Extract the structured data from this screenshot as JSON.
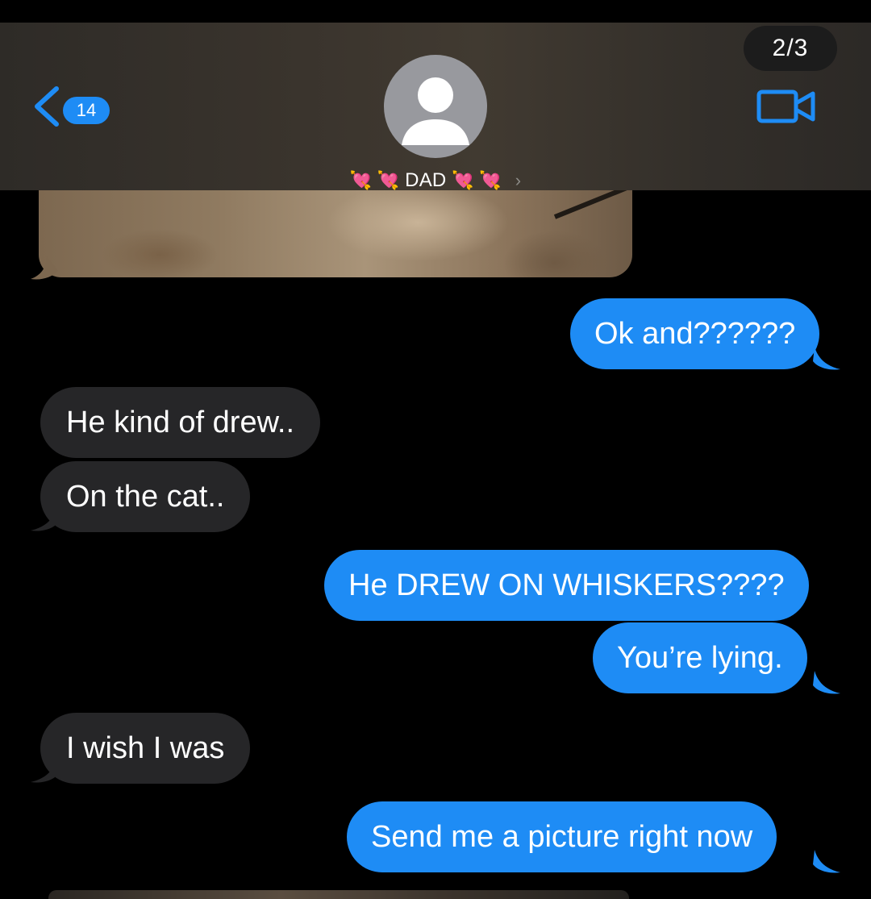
{
  "header": {
    "back_count": "14",
    "contact_prefix_hearts": "💘 💘",
    "contact_name": "DAD",
    "contact_suffix_hearts": "💘 💘",
    "chevron": "›",
    "image_counter": "2/3",
    "icons": {
      "back": "chevron-left-icon",
      "avatar": "person-silhouette-icon",
      "video": "video-camera-icon"
    }
  },
  "colors": {
    "accent": "#1e8cf5",
    "incoming_bubble": "#262628",
    "background": "#000000"
  },
  "messages": [
    {
      "direction": "outgoing",
      "text": "Ok and??????"
    },
    {
      "direction": "incoming",
      "text": "He kind of drew.."
    },
    {
      "direction": "incoming",
      "text": "On the cat.."
    },
    {
      "direction": "outgoing",
      "text": "He DREW ON WHISKERS????"
    },
    {
      "direction": "outgoing",
      "text": "You’re lying."
    },
    {
      "direction": "incoming",
      "text": "I wish I was"
    },
    {
      "direction": "outgoing",
      "text": "Send me a picture right now"
    }
  ]
}
